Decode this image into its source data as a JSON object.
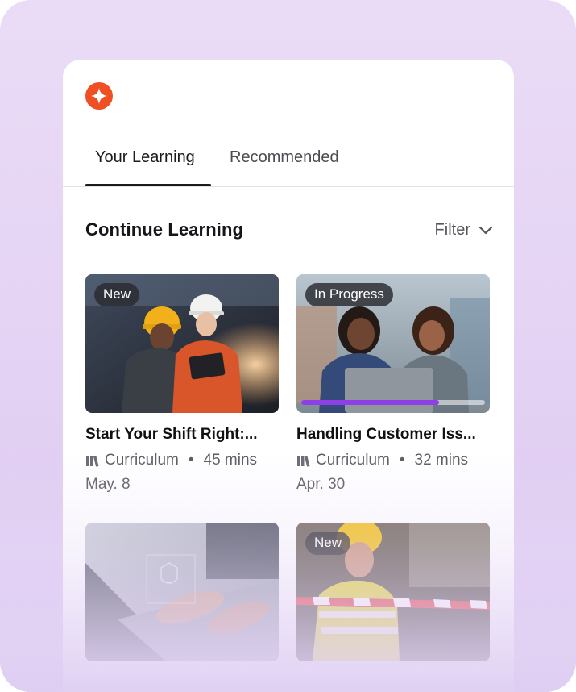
{
  "tabs": [
    {
      "label": "Your Learning",
      "active": true
    },
    {
      "label": "Recommended",
      "active": false
    }
  ],
  "section": {
    "title": "Continue Learning",
    "filter_label": "Filter"
  },
  "courses": [
    {
      "badge": "New",
      "title": "Start Your Shift Right:...",
      "type": "Curriculum",
      "duration": "45 mins",
      "date": "May. 8"
    },
    {
      "badge": "In Progress",
      "title": "Handling Customer Iss...",
      "type": "Curriculum",
      "duration": "32 mins",
      "date": "Apr. 30",
      "progress": 0.75
    },
    {
      "badge": "",
      "title": "",
      "type": "",
      "duration": "",
      "date": ""
    },
    {
      "badge": "New",
      "title": "",
      "type": "",
      "duration": "",
      "date": ""
    }
  ],
  "icons": {
    "logo": "sparkle-logo-icon",
    "filter": "chevron-down-icon",
    "curriculum": "library-icon"
  },
  "colors": {
    "accent": "#ef4f23",
    "progress": "#8e3fe6",
    "background": "#e6d6f5"
  }
}
